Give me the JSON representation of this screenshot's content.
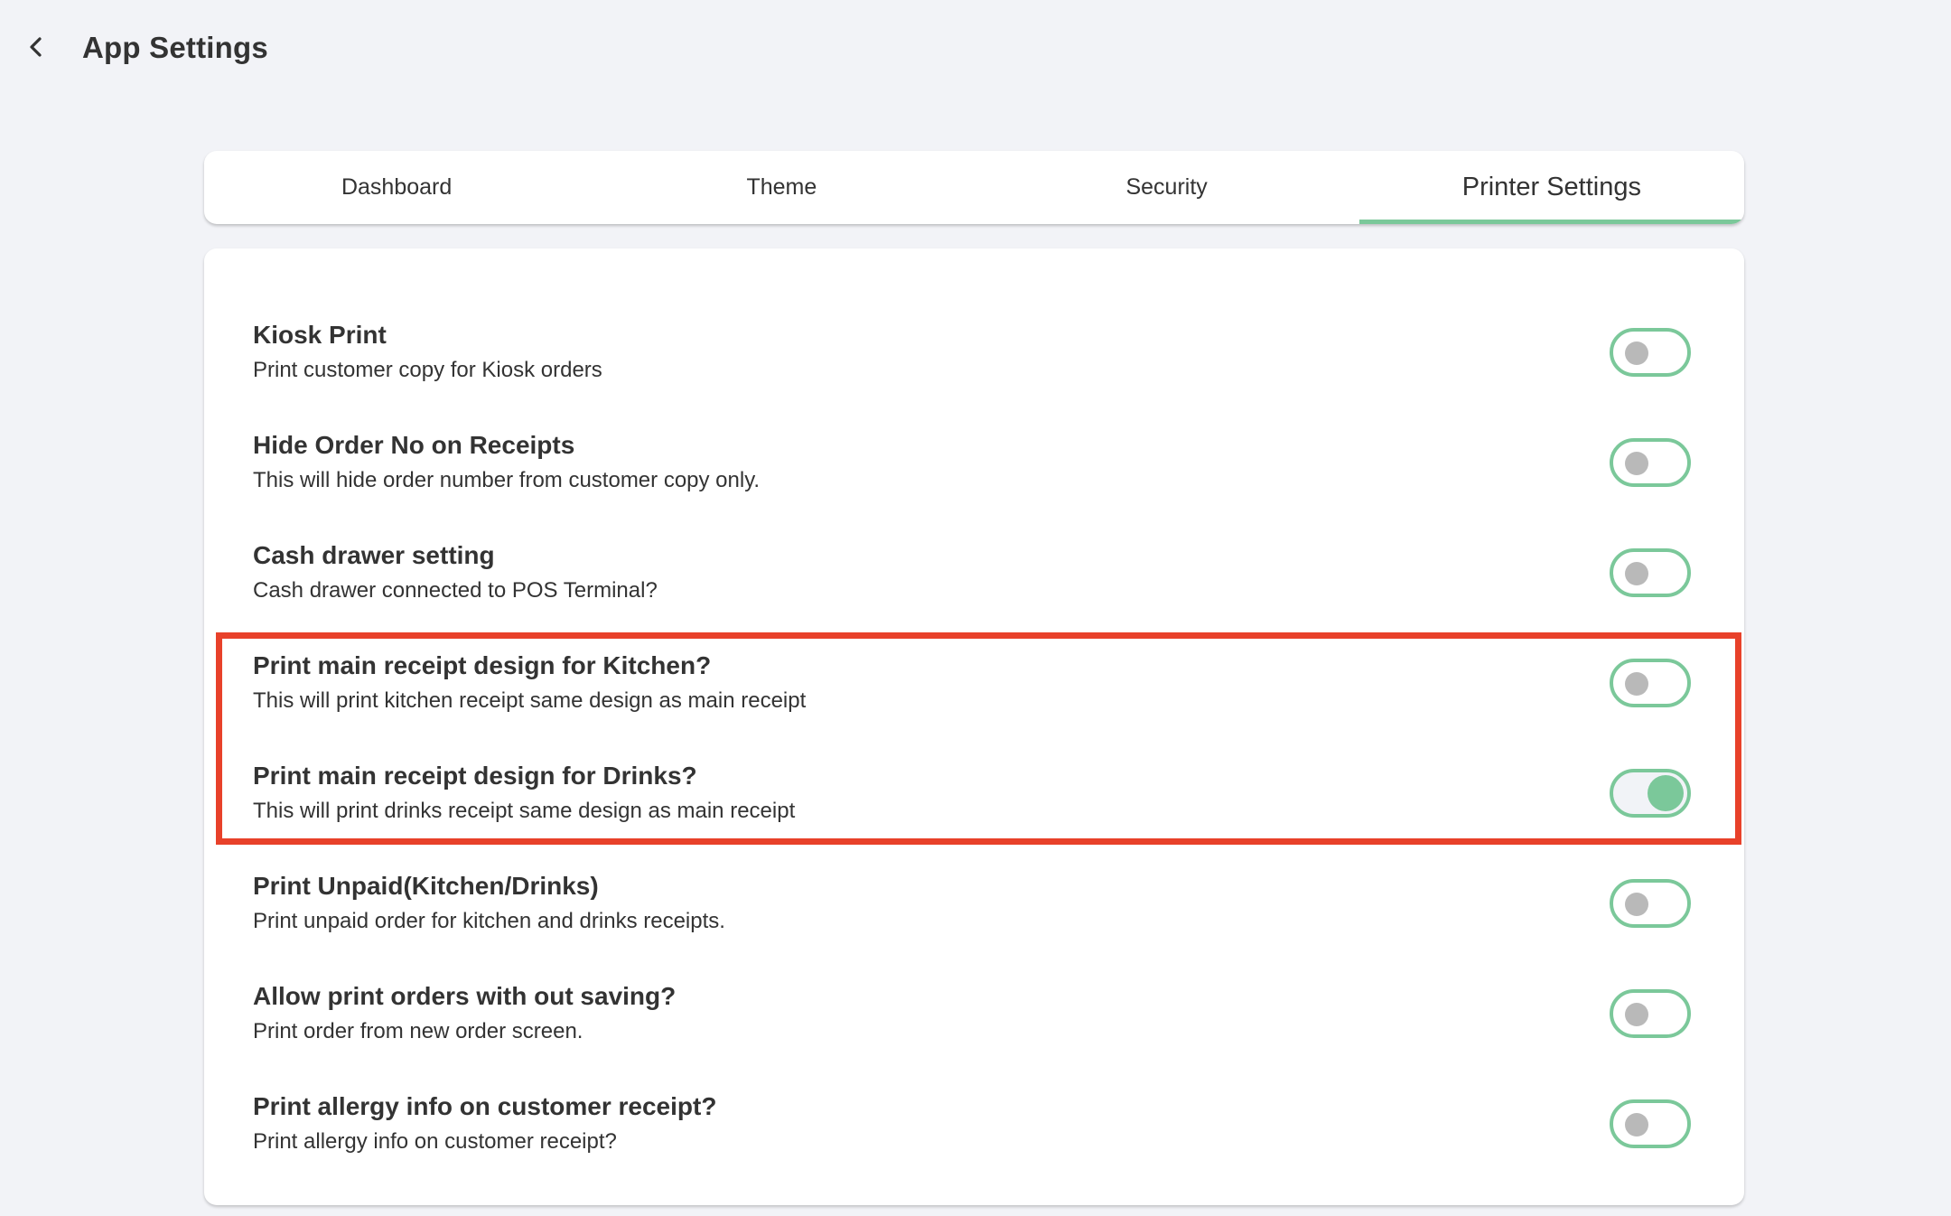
{
  "header": {
    "back_icon": "chevron-left-icon",
    "title": "App Settings"
  },
  "colors": {
    "accent": "#7bc89a",
    "highlight": "#e8412a",
    "background": "#f2f3f7",
    "toggle_knob_off": "#b9b9b9"
  },
  "tabs": [
    {
      "label": "Dashboard",
      "active": false
    },
    {
      "label": "Theme",
      "active": false
    },
    {
      "label": "Security",
      "active": false
    },
    {
      "label": "Printer Settings",
      "active": true
    }
  ],
  "settings": [
    {
      "title": "Kiosk Print",
      "subtitle": "Print customer copy for Kiosk orders",
      "enabled": false
    },
    {
      "title": "Hide Order No on Receipts",
      "subtitle": "This will hide order number from customer copy only.",
      "enabled": false
    },
    {
      "title": "Cash drawer setting",
      "subtitle": "Cash drawer connected to POS Terminal?",
      "enabled": false
    },
    {
      "title": "Print main receipt design for Kitchen?",
      "subtitle": "This will print kitchen receipt same design as main receipt",
      "enabled": false
    },
    {
      "title": "Print main receipt design for Drinks?",
      "subtitle": "This will print drinks receipt same design as main receipt",
      "enabled": true
    },
    {
      "title": "Print Unpaid(Kitchen/Drinks)",
      "subtitle": "Print unpaid order for kitchen and drinks receipts.",
      "enabled": false
    },
    {
      "title": "Allow print orders with out saving?",
      "subtitle": "Print order from new order screen.",
      "enabled": false
    },
    {
      "title": "Print allergy info on customer receipt?",
      "subtitle": "Print allergy info on customer receipt?",
      "enabled": false
    }
  ],
  "highlight": {
    "label": "highlighted-settings",
    "covers_settings": [
      3,
      4
    ]
  }
}
